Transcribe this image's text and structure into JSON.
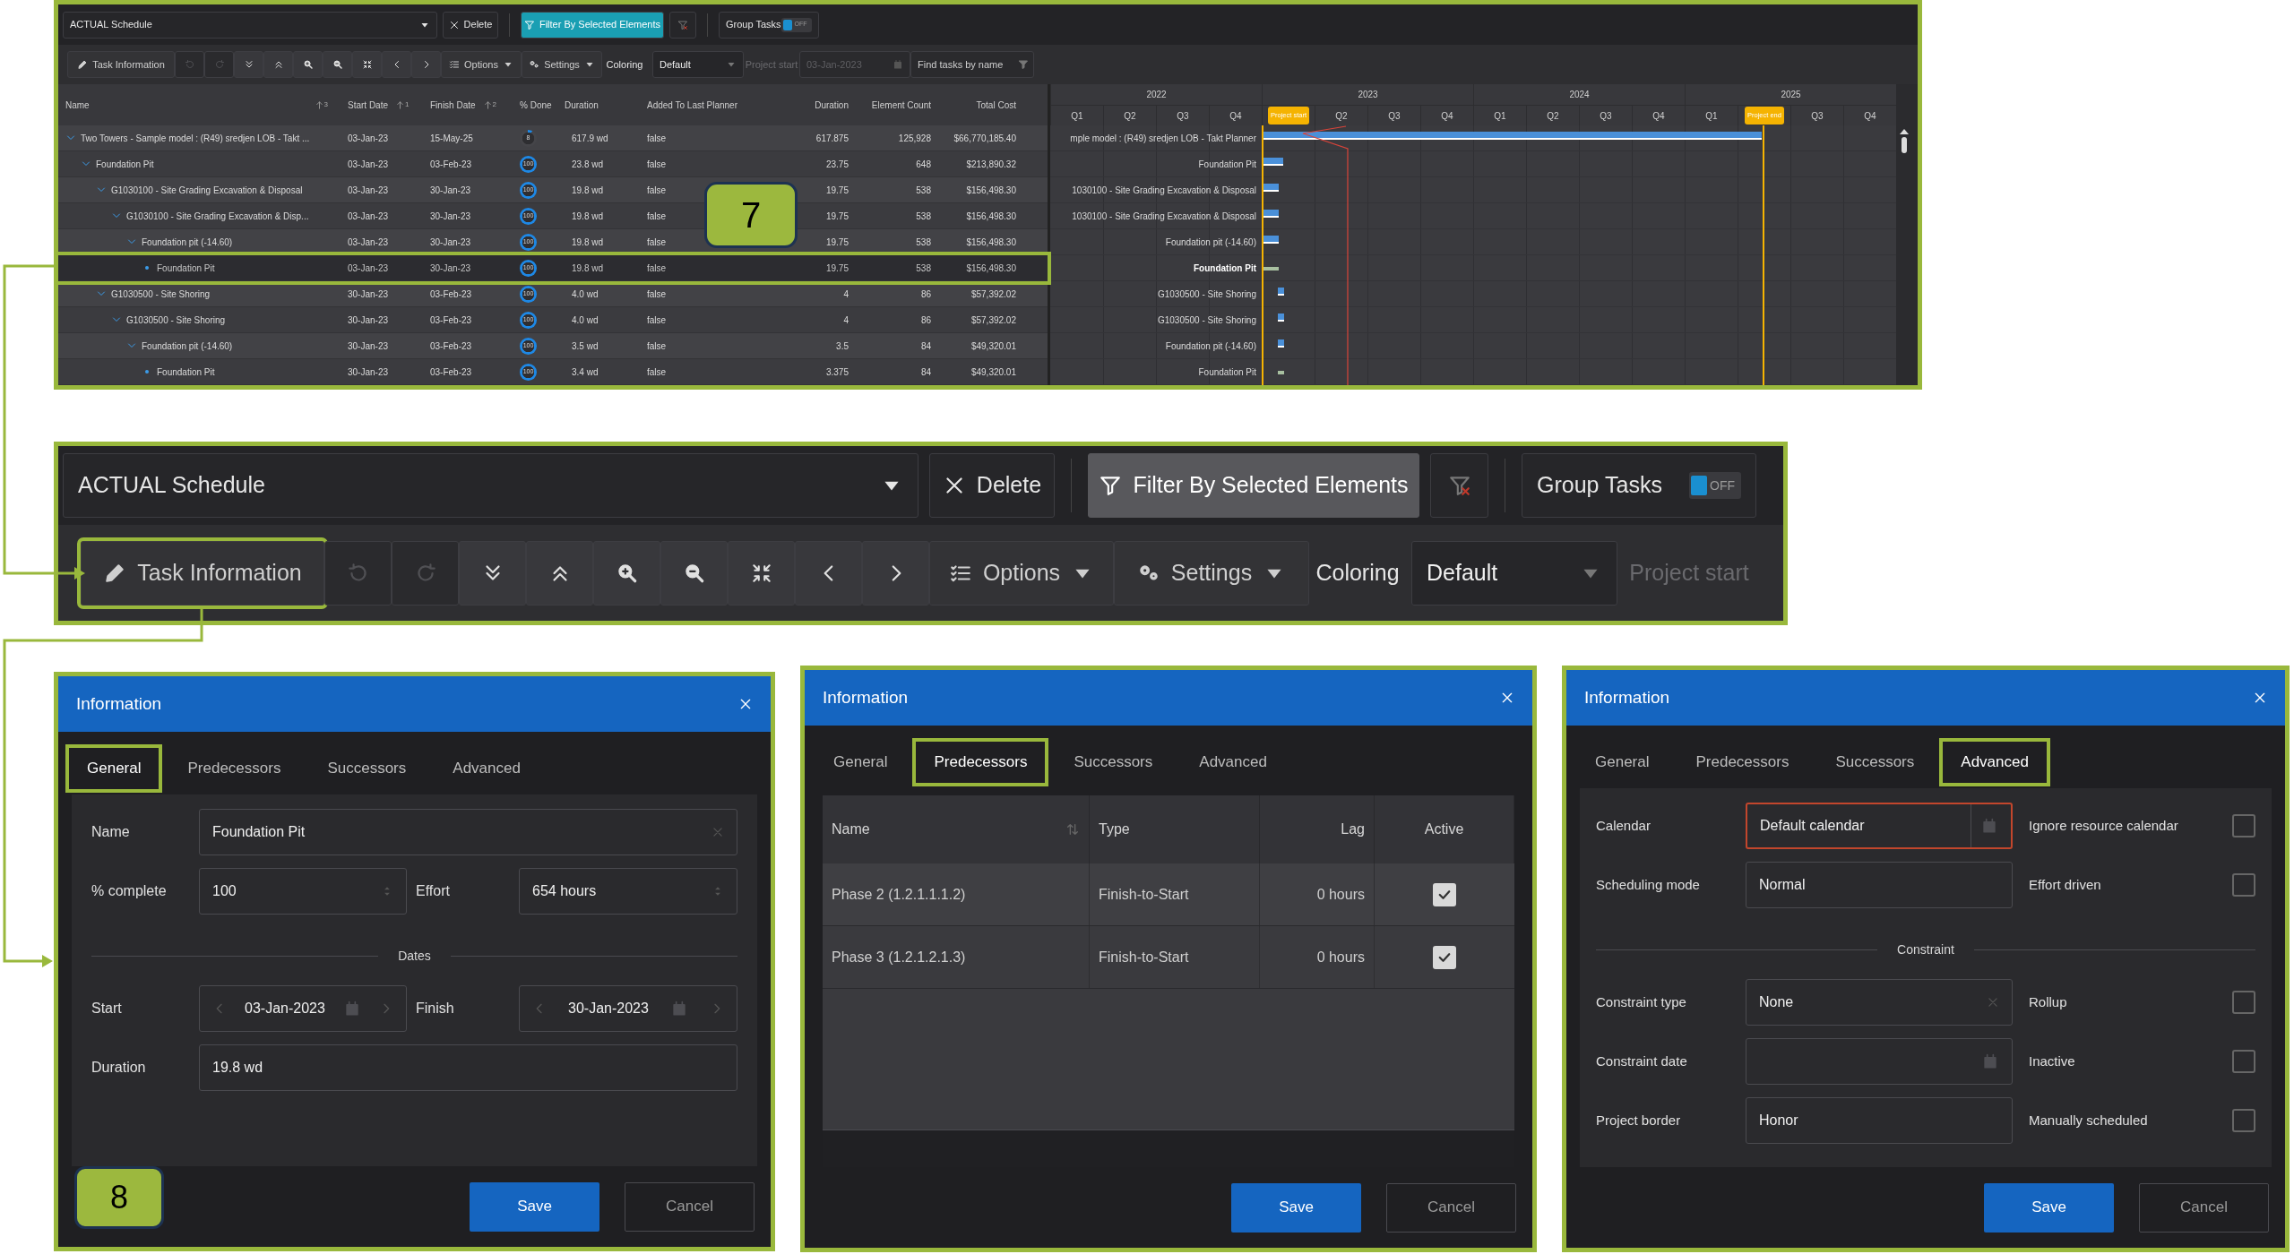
{
  "schedule_panel": {
    "toolbar_row_1": [
      {
        "kind": "dropdown",
        "label": "ACTUAL Schedule"
      },
      {
        "kind": "delete",
        "label": "Delete"
      },
      {
        "kind": "filter",
        "label": "Filter By Selected Elements",
        "active": true
      },
      {
        "kind": "clear-filter"
      },
      {
        "kind": "toggle",
        "label": "Group Tasks",
        "state_text": "OFF",
        "on": false
      }
    ],
    "toolbar_row_2": [
      {
        "kind": "task-info",
        "label": "Task Information",
        "highlighted": false
      },
      {
        "kind": "undo",
        "disabled": true
      },
      {
        "kind": "redo",
        "disabled": true
      },
      {
        "kind": "collapse-all",
        "disabled": false
      },
      {
        "kind": "expand-all",
        "disabled": false
      },
      {
        "kind": "zoom-in",
        "disabled": false
      },
      {
        "kind": "zoom-out",
        "disabled": false
      },
      {
        "kind": "fit",
        "disabled": false
      },
      {
        "kind": "previous",
        "disabled": false
      },
      {
        "kind": "next",
        "disabled": false
      },
      {
        "kind": "options",
        "label": "Options"
      },
      {
        "kind": "settings",
        "label": "Settings"
      },
      {
        "kind": "label",
        "label": "Coloring",
        "disabled": false
      },
      {
        "kind": "select",
        "label": "Default"
      },
      {
        "kind": "label",
        "label": "Project start",
        "disabled": true
      },
      {
        "kind": "date",
        "value": "03-Jan-2023",
        "disabled": true
      },
      {
        "kind": "search",
        "placeholder": "Find tasks by name"
      }
    ],
    "table": {
      "columns": [
        {
          "label": "Name",
          "sort_order": "3"
        },
        {
          "label": "Start Date",
          "sort_order": "1"
        },
        {
          "label": "Finish Date",
          "sort_order": "2"
        },
        {
          "label": "% Done"
        },
        {
          "label": "Duration"
        },
        {
          "label": "Added To Last Planner"
        },
        {
          "label": "Duration"
        },
        {
          "label": "Element Count"
        },
        {
          "label": "Total Cost"
        }
      ],
      "rows": [
        {
          "name": "Two Towers - Sample model : (R49) sredjen LOB - Takt ...",
          "start": "03-Jan-23",
          "finish": "15-May-25",
          "done": "8",
          "duration": "617.9 wd",
          "added": "false",
          "duration_value": "617.875",
          "element_count": "125,928",
          "total_cost": "$66,770,185.40",
          "expanded": true,
          "selected": false,
          "children": [
            {
              "name": "Foundation Pit",
              "start": "03-Jan-23",
              "finish": "03-Feb-23",
              "done": "100",
              "duration": "23.8 wd",
              "added": "false",
              "duration_value": "23.75",
              "element_count": "648",
              "total_cost": "$213,890.32",
              "expanded": true,
              "selected": false,
              "children": [
                {
                  "name": "G1030100 - Site Grading Excavation & Disposal",
                  "start": "03-Jan-23",
                  "finish": "30-Jan-23",
                  "done": "100",
                  "duration": "19.8 wd",
                  "added": "false",
                  "duration_value": "19.75",
                  "element_count": "538",
                  "total_cost": "$156,498.30",
                  "expanded": true,
                  "selected": false,
                  "children": [
                    {
                      "name": "G1030100 - Site Grading Excavation & Disp...",
                      "start": "03-Jan-23",
                      "finish": "30-Jan-23",
                      "done": "100",
                      "duration": "19.8 wd",
                      "added": "false",
                      "duration_value": "19.75",
                      "element_count": "538",
                      "total_cost": "$156,498.30",
                      "expanded": true,
                      "selected": false,
                      "children": [
                        {
                          "name": "Foundation pit (-14.60)",
                          "start": "03-Jan-23",
                          "finish": "30-Jan-23",
                          "done": "100",
                          "duration": "19.8 wd",
                          "added": "false",
                          "duration_value": "19.75",
                          "element_count": "538",
                          "total_cost": "$156,498.30",
                          "expanded": true,
                          "selected": false,
                          "children": [
                            {
                              "name": "Foundation Pit",
                              "start": "03-Jan-23",
                              "finish": "30-Jan-23",
                              "done": "100",
                              "duration": "19.8 wd",
                              "added": "false",
                              "duration_value": "19.75",
                              "element_count": "538",
                              "total_cost": "$156,498.30",
                              "selected": true
                            }
                          ]
                        }
                      ]
                    }
                  ]
                },
                {
                  "name": "G1030500 - Site Shoring",
                  "start": "30-Jan-23",
                  "finish": "03-Feb-23",
                  "done": "100",
                  "duration": "4.0 wd",
                  "added": "false",
                  "duration_value": "4",
                  "element_count": "86",
                  "total_cost": "$57,392.02",
                  "expanded": true,
                  "selected": false,
                  "children": [
                    {
                      "name": "G1030500 - Site Shoring",
                      "start": "30-Jan-23",
                      "finish": "03-Feb-23",
                      "done": "100",
                      "duration": "4.0 wd",
                      "added": "false",
                      "duration_value": "4",
                      "element_count": "86",
                      "total_cost": "$57,392.02",
                      "expanded": true,
                      "selected": false,
                      "children": [
                        {
                          "name": "Foundation pit (-14.60)",
                          "start": "30-Jan-23",
                          "finish": "03-Feb-23",
                          "done": "100",
                          "duration": "3.5 wd",
                          "added": "false",
                          "duration_value": "3.5",
                          "element_count": "84",
                          "total_cost": "$49,320.01",
                          "expanded": true,
                          "selected": false,
                          "children": [
                            {
                              "name": "Foundation Pit",
                              "start": "30-Jan-23",
                              "finish": "03-Feb-23",
                              "done": "100",
                              "duration": "3.4 wd",
                              "added": "false",
                              "duration_value": "3.375",
                              "element_count": "84",
                              "total_cost": "$49,320.01",
                              "selected": false
                            }
                          ]
                        }
                      ]
                    }
                  ]
                }
              ]
            }
          ]
        }
      ]
    },
    "gantt": {
      "years": [
        "2022",
        "2023",
        "2024",
        "2025"
      ],
      "quarters": [
        {
          "kind": "quarter",
          "label": "Q1"
        },
        {
          "kind": "quarter",
          "label": "Q2"
        },
        {
          "kind": "quarter",
          "label": "Q3"
        },
        {
          "kind": "quarter",
          "label": "Q4"
        },
        {
          "kind": "marker",
          "label": "Project start"
        },
        {
          "kind": "quarter",
          "label": "Q2"
        },
        {
          "kind": "quarter",
          "label": "Q3"
        },
        {
          "kind": "quarter",
          "label": "Q4"
        },
        {
          "kind": "quarter",
          "label": "Q1"
        },
        {
          "kind": "quarter",
          "label": "Q2"
        },
        {
          "kind": "quarter",
          "label": "Q3"
        },
        {
          "kind": "quarter",
          "label": "Q4"
        },
        {
          "kind": "quarter",
          "label": "Q1"
        },
        {
          "kind": "marker",
          "label": "Project end"
        },
        {
          "kind": "quarter",
          "label": "Q3"
        },
        {
          "kind": "quarter",
          "label": "Q4"
        }
      ],
      "rows": [
        {
          "label": "mple model : (R49) sredjen LOB - Takt Planner",
          "selected": false
        },
        {
          "label": "Foundation Pit",
          "selected": false
        },
        {
          "label": "1030100 - Site Grading Excavation & Disposal",
          "selected": false
        },
        {
          "label": "1030100 - Site Grading Excavation & Disposal",
          "selected": false
        },
        {
          "label": "Foundation pit (-14.60)",
          "selected": false
        },
        {
          "label": "Foundation Pit",
          "selected": true
        },
        {
          "label": "G1030500 - Site Shoring",
          "selected": false
        },
        {
          "label": "G1030500 - Site Shoring",
          "selected": false
        },
        {
          "label": "Foundation pit (-14.60)",
          "selected": false
        },
        {
          "label": "Foundation Pit",
          "selected": false
        }
      ]
    },
    "callout": "7"
  },
  "toolbar_zoom": {
    "row_1": [
      {
        "kind": "dropdown",
        "label": "ACTUAL Schedule"
      },
      {
        "kind": "delete",
        "label": "Delete"
      },
      {
        "kind": "filter",
        "label": "Filter By Selected Elements",
        "active": false
      },
      {
        "kind": "clear-filter"
      },
      {
        "kind": "toggle",
        "label": "Group Tasks",
        "state_text": "OFF",
        "on": false
      }
    ],
    "row_2": [
      {
        "kind": "task-info",
        "label": "Task Information",
        "highlighted": true
      },
      {
        "kind": "undo",
        "disabled": true
      },
      {
        "kind": "redo",
        "disabled": true
      },
      {
        "kind": "collapse-all",
        "disabled": false
      },
      {
        "kind": "expand-all",
        "disabled": false
      },
      {
        "kind": "zoom-in",
        "disabled": false
      },
      {
        "kind": "zoom-out",
        "disabled": false
      },
      {
        "kind": "fit",
        "disabled": false
      },
      {
        "kind": "previous",
        "disabled": false
      },
      {
        "kind": "next",
        "disabled": false
      },
      {
        "kind": "options",
        "label": "Options"
      },
      {
        "kind": "settings",
        "label": "Settings"
      },
      {
        "kind": "label",
        "label": "Coloring",
        "disabled": false
      },
      {
        "kind": "select",
        "label": "Default"
      },
      {
        "kind": "label",
        "label": "Project start",
        "disabled": true
      }
    ]
  },
  "dialogs": [
    {
      "title": "Information",
      "kind": "general",
      "tabs": [
        {
          "label": "General",
          "selected": true
        },
        {
          "label": "Predecessors",
          "selected": false
        },
        {
          "label": "Successors",
          "selected": false
        },
        {
          "label": "Advanced",
          "selected": false
        }
      ],
      "rows": [
        {
          "kind": "field",
          "label": "Name",
          "field": {
            "kind": "clearable",
            "value": "Foundation Pit"
          }
        },
        {
          "kind": "pair",
          "label": "% complete",
          "field": {
            "kind": "spinner",
            "value": "100"
          },
          "label_2": "Effort",
          "field_2": {
            "kind": "spinner",
            "value": "654 hours"
          }
        },
        {
          "kind": "divider",
          "label": "Dates"
        },
        {
          "kind": "pair",
          "label": "Start",
          "field": {
            "kind": "date-nav",
            "value": "03-Jan-2023"
          },
          "label_2": "Finish",
          "field_2": {
            "kind": "date-nav",
            "value": "30-Jan-2023"
          }
        },
        {
          "kind": "field",
          "label": "Duration",
          "field": {
            "kind": "text",
            "value": "19.8 wd"
          }
        }
      ],
      "buttons": [
        {
          "kind": "primary",
          "label": "Save"
        },
        {
          "kind": "secondary",
          "label": "Cancel"
        }
      ],
      "callout": "8"
    },
    {
      "title": "Information",
      "kind": "predecessors",
      "tabs": [
        {
          "label": "General",
          "selected": false
        },
        {
          "label": "Predecessors",
          "selected": true
        },
        {
          "label": "Successors",
          "selected": false
        },
        {
          "label": "Advanced",
          "selected": false
        }
      ],
      "grid": {
        "columns": [
          {
            "label": "Name",
            "sortable": true
          },
          {
            "label": "Type",
            "sortable": false
          },
          {
            "label": "Lag",
            "sortable": false
          },
          {
            "label": "Active",
            "sortable": false
          }
        ],
        "rows": [
          {
            "name": "Phase 2 (1.2.1.1.1.2)",
            "type": "Finish-to-Start",
            "lag": "0 hours",
            "active": true
          },
          {
            "name": "Phase 3 (1.2.1.2.1.3)",
            "type": "Finish-to-Start",
            "lag": "0 hours",
            "active": true
          }
        ]
      },
      "buttons": [
        {
          "kind": "primary",
          "label": "Save"
        },
        {
          "kind": "secondary",
          "label": "Cancel"
        }
      ]
    },
    {
      "title": "Information",
      "kind": "advanced",
      "tabs": [
        {
          "label": "General",
          "selected": false
        },
        {
          "label": "Predecessors",
          "selected": false
        },
        {
          "label": "Successors",
          "selected": false
        },
        {
          "label": "Advanced",
          "selected": true
        }
      ],
      "rows": [
        {
          "kind": "pair",
          "field": {
            "label": "Calendar",
            "kind": "calendar-select",
            "value": "Default calendar",
            "focused": true
          },
          "option": {
            "label": "Ignore resource calendar",
            "checked": false
          }
        },
        {
          "kind": "pair",
          "field": {
            "label": "Scheduling mode",
            "kind": "text",
            "value": "Normal",
            "focused": false
          },
          "option": {
            "label": "Effort driven",
            "checked": false
          }
        },
        {
          "kind": "divider",
          "label": "Constraint"
        },
        {
          "kind": "pair",
          "field": {
            "label": "Constraint type",
            "kind": "clearable",
            "value": "None",
            "focused": false
          },
          "option": {
            "label": "Rollup",
            "checked": false
          }
        },
        {
          "kind": "pair",
          "field": {
            "label": "Constraint date",
            "kind": "date",
            "focused": false
          },
          "option": {
            "label": "Inactive",
            "checked": false
          }
        },
        {
          "kind": "pair",
          "field": {
            "label": "Project border",
            "kind": "text",
            "value": "Honor",
            "focused": false
          },
          "option": {
            "label": "Manually scheduled",
            "checked": false
          }
        }
      ],
      "buttons": [
        {
          "kind": "primary",
          "label": "Save"
        },
        {
          "kind": "secondary",
          "label": "Cancel"
        }
      ]
    }
  ]
}
